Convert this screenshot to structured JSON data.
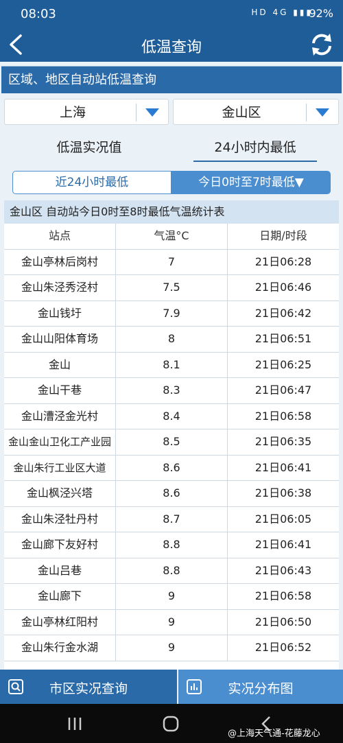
{
  "status_bar": {
    "time": "08:03",
    "network": "HD 4G",
    "battery": "92%"
  },
  "header": {
    "title": "低温查询"
  },
  "section": {
    "title": "区域、地区自动站低温查询"
  },
  "selectors": {
    "city": "上海",
    "district": "金山区"
  },
  "modes": {
    "realtime": "低温实况值",
    "min24": "24小时内最低"
  },
  "segments": {
    "last24": "近24小时最低",
    "today": "今日0时至7时最低▼"
  },
  "table": {
    "caption": "金山区 自动站今日0时至8时最低气温统计表",
    "headers": [
      "站点",
      "气温°C",
      "日期/时段"
    ],
    "rows": [
      [
        "金山亭林后岗村",
        "7",
        "21日06:28"
      ],
      [
        "金山朱泾秀泾村",
        "7.5",
        "21日06:46"
      ],
      [
        "金山钱圩",
        "7.9",
        "21日06:42"
      ],
      [
        "金山山阳体育场",
        "8",
        "21日06:51"
      ],
      [
        "金山",
        "8.1",
        "21日06:25"
      ],
      [
        "金山干巷",
        "8.3",
        "21日06:47"
      ],
      [
        "金山漕泾金光村",
        "8.4",
        "21日06:58"
      ],
      [
        "金山金山卫化工产业园",
        "8.5",
        "21日06:35"
      ],
      [
        "金山朱行工业区大道",
        "8.6",
        "21日06:41"
      ],
      [
        "金山枫泾兴塔",
        "8.6",
        "21日06:38"
      ],
      [
        "金山朱泾牡丹村",
        "8.7",
        "21日06:05"
      ],
      [
        "金山廊下友好村",
        "8.8",
        "21日06:41"
      ],
      [
        "金山吕巷",
        "8.8",
        "21日06:43"
      ],
      [
        "金山廊下",
        "9",
        "21日06:58"
      ],
      [
        "金山亭林红阳村",
        "9",
        "21日06:50"
      ],
      [
        "金山朱行金水湖",
        "9",
        "21日06:52"
      ]
    ]
  },
  "bottom_tabs": {
    "city_query": "市区实况查询",
    "distribution": "实况分布图"
  },
  "watermark": "@上海天气通-花藤龙心"
}
